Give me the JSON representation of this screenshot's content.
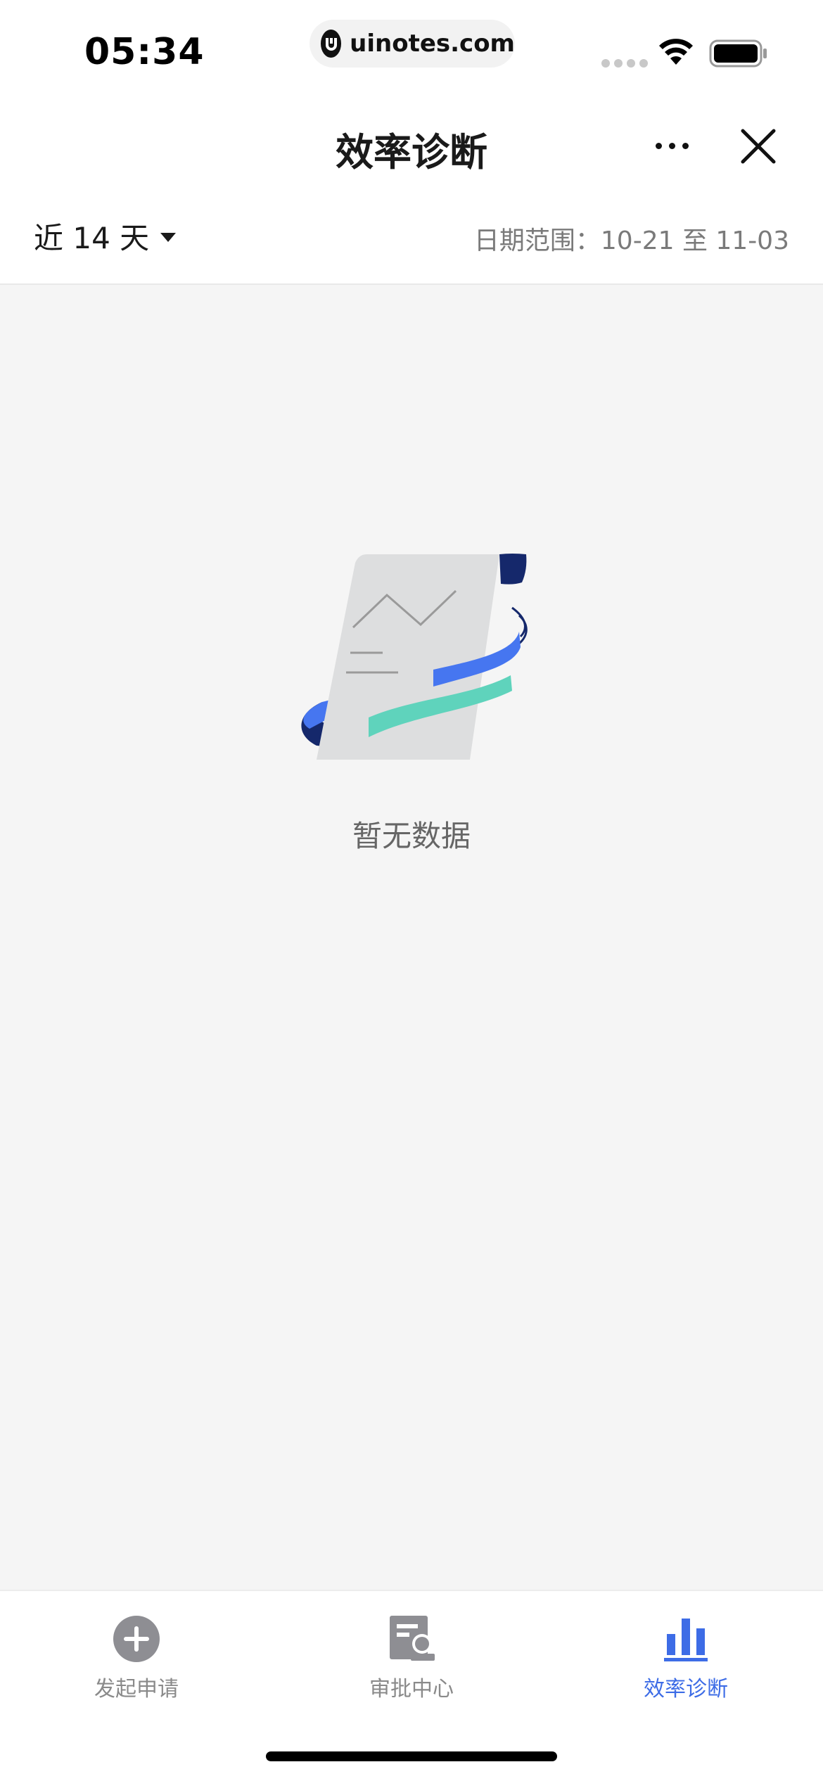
{
  "status_bar": {
    "time": "05:34",
    "url": "uinotes.com"
  },
  "nav": {
    "title": "效率诊断"
  },
  "filter": {
    "range_label": "近 14 天",
    "date_range": "日期范围：10-21 至 11-03"
  },
  "empty_state": {
    "message": "暂无数据"
  },
  "tabs": [
    {
      "label": "发起申请",
      "icon": "add-circle-icon",
      "active": false
    },
    {
      "label": "审批中心",
      "icon": "approval-doc-icon",
      "active": false
    },
    {
      "label": "效率诊断",
      "icon": "bar-chart-icon",
      "active": true
    }
  ],
  "colors": {
    "accent": "#3d6ce6",
    "inactive": "#8a8a8a",
    "illustration_navy": "#15286b",
    "illustration_blue": "#4676f0",
    "illustration_green": "#5fd3bc"
  }
}
